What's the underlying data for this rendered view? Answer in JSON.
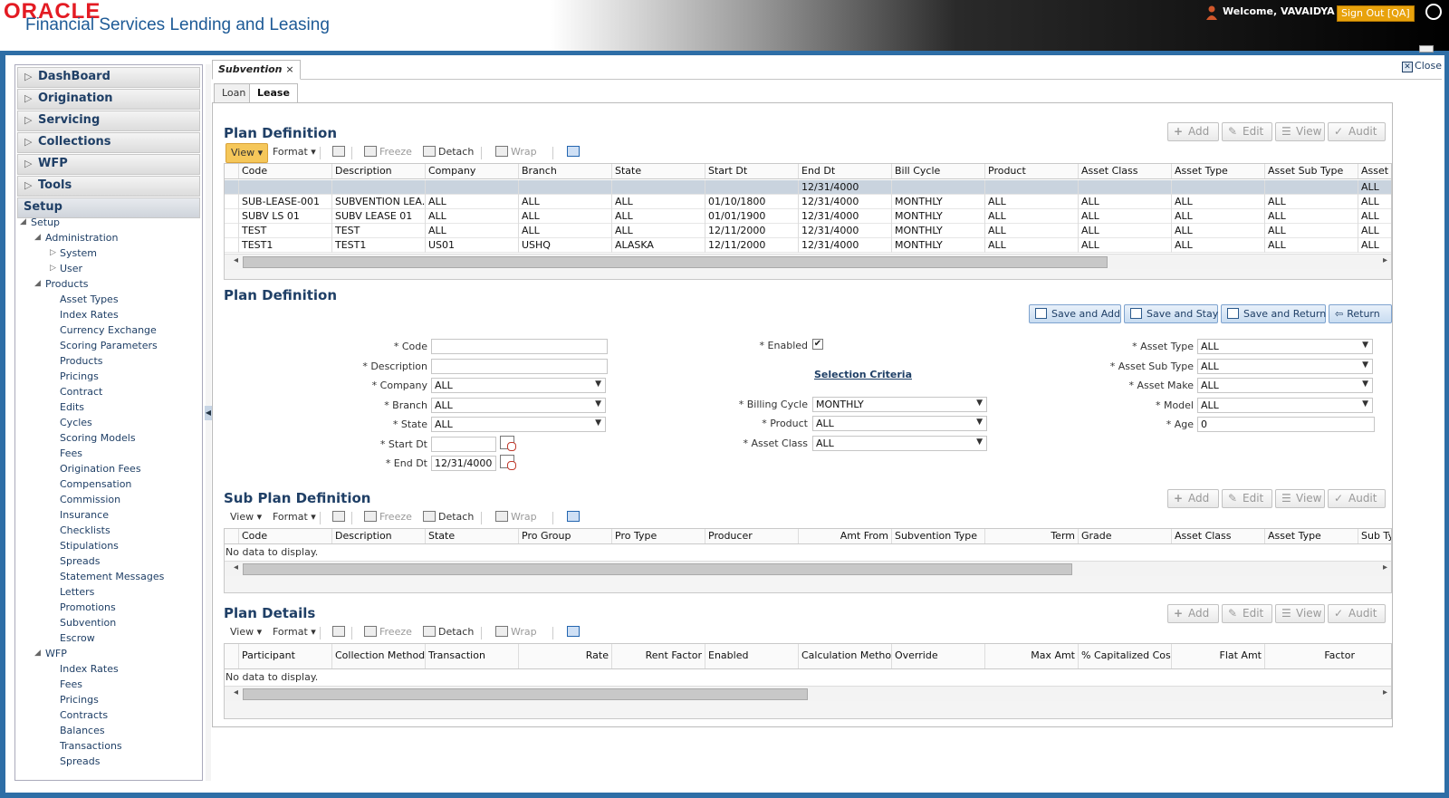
{
  "header": {
    "logo_top": "ORACLE",
    "logo_sub": "Financial Services Lending and Leasing",
    "welcome": "Welcome, VAVAIDYA",
    "sign_out": "Sign Out [QA]",
    "colors": {
      "brand_red": "#e31b23",
      "brand_blue": "#1d5a96",
      "signout": "#e8a20c"
    }
  },
  "sidebar": {
    "menus": [
      "DashBoard",
      "Origination",
      "Servicing",
      "Collections",
      "WFP",
      "Tools"
    ],
    "setup_label": "Setup",
    "tree": {
      "root": "Setup",
      "administration": "Administration",
      "admin_children": [
        "System",
        "User"
      ],
      "products": "Products",
      "product_children": [
        "Asset Types",
        "Index Rates",
        "Currency Exchange",
        "Scoring Parameters",
        "Products",
        "Pricings",
        "Contract",
        "Edits",
        "Cycles",
        "Scoring Models",
        "Fees",
        "Origination Fees",
        "Compensation",
        "Commission",
        "Insurance",
        "Checklists",
        "Stipulations",
        "Spreads",
        "Statement Messages",
        "Letters",
        "Promotions",
        "Subvention",
        "Escrow"
      ],
      "wfp": "WFP",
      "wfp_children": [
        "Index Rates",
        "Fees",
        "Pricings",
        "Contracts",
        "Balances",
        "Transactions",
        "Spreads"
      ]
    }
  },
  "main": {
    "tab_title": "Subvention",
    "close_label": "Close",
    "subtabs": [
      "Loan",
      "Lease"
    ],
    "toolbar": {
      "view": "View",
      "format": "Format",
      "freeze": "Freeze",
      "detach": "Detach",
      "wrap": "Wrap"
    },
    "action_buttons": {
      "add": "Add",
      "edit": "Edit",
      "view": "View",
      "audit": "Audit"
    },
    "plan_definition_grid": {
      "title": "Plan Definition",
      "columns": [
        "Code",
        "Description",
        "Company",
        "Branch",
        "State",
        "Start Dt",
        "End Dt",
        "Bill Cycle",
        "Product",
        "Asset Class",
        "Asset Type",
        "Asset Sub Type",
        "Asset Ma"
      ],
      "rows": [
        [
          "",
          "",
          "",
          "",
          "",
          "",
          "12/31/4000",
          "",
          "",
          "",
          "",
          "",
          "ALL"
        ],
        [
          "SUB-LEASE-001",
          "SUBVENTION LEA...",
          "ALL",
          "ALL",
          "ALL",
          "01/10/1800",
          "12/31/4000",
          "MONTHLY",
          "ALL",
          "ALL",
          "ALL",
          "ALL",
          "ALL"
        ],
        [
          "SUBV LS 01",
          "SUBV LEASE 01",
          "ALL",
          "ALL",
          "ALL",
          "01/01/1900",
          "12/31/4000",
          "MONTHLY",
          "ALL",
          "ALL",
          "ALL",
          "ALL",
          "ALL"
        ],
        [
          "TEST",
          "TEST",
          "ALL",
          "ALL",
          "ALL",
          "12/11/2000",
          "12/31/4000",
          "MONTHLY",
          "ALL",
          "ALL",
          "ALL",
          "ALL",
          "ALL"
        ],
        [
          "TEST1",
          "TEST1",
          "US01",
          "USHQ",
          "ALASKA",
          "12/11/2000",
          "12/31/4000",
          "MONTHLY",
          "ALL",
          "ALL",
          "ALL",
          "ALL",
          "ALL"
        ]
      ]
    },
    "plan_definition_form": {
      "title": "Plan Definition",
      "buttons": {
        "save_add": "Save and Add",
        "save_stay": "Save and Stay",
        "save_return": "Save and Return",
        "return": "Return"
      },
      "labels": {
        "code": "* Code",
        "description": "* Description",
        "company": "* Company",
        "branch": "* Branch",
        "state": "* State",
        "start_dt": "* Start Dt",
        "end_dt": "* End Dt",
        "enabled": "* Enabled",
        "selection_criteria": "Selection Criteria",
        "billing_cycle": "* Billing Cycle",
        "product": "* Product",
        "asset_class": "* Asset Class",
        "asset_type": "* Asset Type",
        "asset_sub_type": "* Asset Sub Type",
        "asset_make": "* Asset Make",
        "model": "* Model",
        "age": "* Age"
      },
      "values": {
        "code": "",
        "description": "",
        "company": "ALL",
        "branch": "ALL",
        "state": "ALL",
        "start_dt": "",
        "end_dt": "12/31/4000",
        "enabled": "✔",
        "billing_cycle": "MONTHLY",
        "product": "ALL",
        "asset_class": "ALL",
        "asset_type": "ALL",
        "asset_sub_type": "ALL",
        "asset_make": "ALL",
        "model": "ALL",
        "age": "0"
      }
    },
    "sub_plan_grid": {
      "title": "Sub Plan Definition",
      "columns": [
        "Code",
        "Description",
        "State",
        "Pro Group",
        "Pro Type",
        "Producer",
        "Amt From",
        "Subvention Type",
        "Term",
        "Grade",
        "Asset Class",
        "Asset Type",
        "Sub Type"
      ],
      "empty": "No data to display."
    },
    "plan_details_grid": {
      "title": "Plan Details",
      "columns": [
        "Participant",
        "Collection Method",
        "Transaction",
        "Rate",
        "Rent Factor",
        "Enabled",
        "Calculation Method",
        "Override",
        "Max Amt",
        "% Capitalized Cost",
        "Flat Amt",
        "Factor"
      ],
      "empty": "No data to display."
    }
  }
}
